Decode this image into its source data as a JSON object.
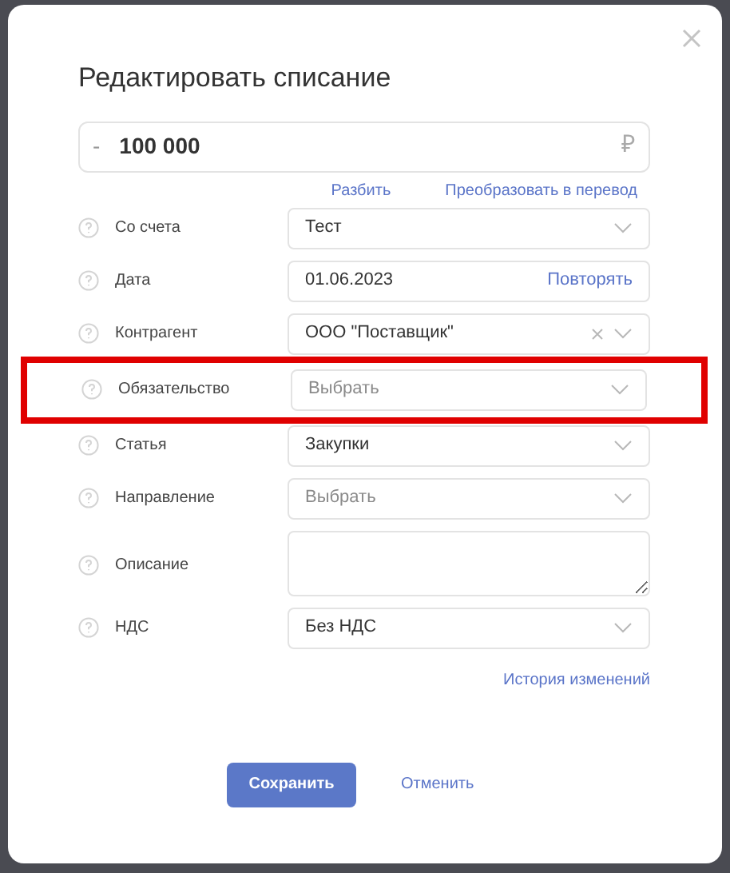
{
  "dialog": {
    "title": "Редактировать списание"
  },
  "amount": {
    "sign": "-",
    "value": "100 000",
    "currency": "₽"
  },
  "amount_links": [
    "Разбить",
    "Преобразовать в перевод"
  ],
  "fields": [
    {
      "kind": "select",
      "label": "Со счета",
      "value": "Тест",
      "highlighted": false
    },
    {
      "kind": "date",
      "label": "Дата",
      "value": "01.06.2023",
      "action": "Повторять",
      "highlighted": false
    },
    {
      "kind": "clearable",
      "label": "Контрагент",
      "value": "ООО \"Поставщик\"",
      "highlighted": false
    },
    {
      "kind": "select",
      "label": "Обязательство",
      "placeholder": "Выбрать",
      "highlighted": true
    },
    {
      "kind": "select",
      "label": "Статья",
      "value": "Закупки",
      "highlighted": false
    },
    {
      "kind": "select",
      "label": "Направление",
      "placeholder": "Выбрать",
      "highlighted": false
    },
    {
      "kind": "textarea",
      "label": "Описание",
      "highlighted": false
    },
    {
      "kind": "select",
      "label": "НДС",
      "value": "Без НДС",
      "highlighted": false
    }
  ],
  "history_link": "История изменений",
  "buttons": {
    "save": "Сохранить",
    "cancel": "Отменить"
  }
}
